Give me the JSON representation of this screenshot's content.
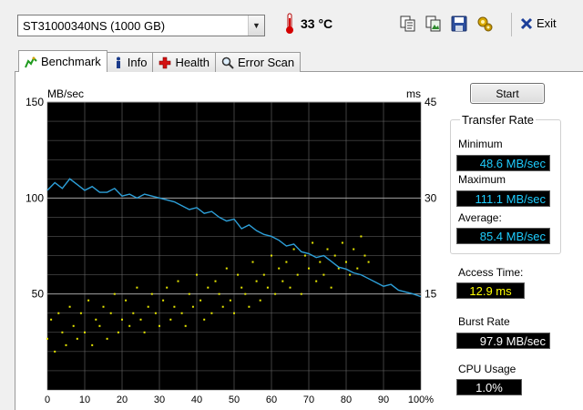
{
  "toolbar": {
    "drive": "ST31000340NS (1000 GB)",
    "temperature": "33 °C",
    "exit_label": "Exit",
    "icons": [
      "copy-text-icon",
      "copy-image-icon",
      "save-icon",
      "options-icon"
    ]
  },
  "tabs": [
    {
      "label": "Benchmark",
      "icon": "benchmark-icon",
      "active": true
    },
    {
      "label": "Info",
      "icon": "info-icon",
      "active": false
    },
    {
      "label": "Health",
      "icon": "health-cross-icon",
      "active": false
    },
    {
      "label": "Error Scan",
      "icon": "magnifier-icon",
      "active": false
    }
  ],
  "buttons": {
    "start": "Start"
  },
  "stats": {
    "transfer_rate_title": "Transfer Rate",
    "minimum_label": "Minimum",
    "minimum_value": "48.6 MB/sec",
    "maximum_label": "Maximum",
    "maximum_value": "111.1 MB/sec",
    "average_label": "Average:",
    "average_value": "85.4 MB/sec",
    "access_label": "Access Time:",
    "access_value": "12.9 ms",
    "burst_label": "Burst Rate",
    "burst_value": "97.9 MB/sec",
    "cpu_label": "CPU Usage",
    "cpu_value": "1.0%"
  },
  "colors": {
    "line": "#2d9fd8",
    "dots": "#e8e800",
    "grid": "#6b6b6b",
    "plot_bg": "#000000"
  },
  "chart_data": {
    "type": "line",
    "left_axis_label": "MB/sec",
    "right_axis_label": "ms",
    "left_ticks": [
      150,
      100,
      50
    ],
    "right_ticks": [
      45,
      30,
      15
    ],
    "x_ticks": [
      "0",
      "10",
      "20",
      "30",
      "40",
      "50",
      "60",
      "70",
      "80",
      "90",
      "100%"
    ],
    "xlim": [
      0,
      100
    ],
    "ylim_left": [
      0,
      150
    ],
    "ylim_right": [
      0,
      45
    ],
    "grid": true,
    "series": [
      {
        "axis": "left",
        "x": [
          0,
          2,
          4,
          6,
          8,
          10,
          12,
          14,
          16,
          18,
          20,
          22,
          24,
          26,
          28,
          30,
          32,
          34,
          36,
          38,
          40,
          42,
          44,
          46,
          48,
          50,
          52,
          54,
          56,
          58,
          60,
          62,
          64,
          66,
          68,
          70,
          72,
          74,
          76,
          78,
          80,
          82,
          84,
          86,
          88,
          90,
          92,
          94,
          96,
          98,
          100
        ],
        "values": [
          104,
          108,
          105,
          110,
          107,
          104,
          106,
          103,
          103,
          105,
          101,
          102,
          100,
          102,
          101,
          100,
          99,
          98,
          96,
          94,
          95,
          92,
          93,
          90,
          88,
          89,
          84,
          86,
          83,
          81,
          80,
          78,
          75,
          76,
          72,
          71,
          69,
          70,
          67,
          64,
          63,
          61,
          60,
          58,
          56,
          54,
          55,
          52,
          51,
          50,
          48.6
        ]
      }
    ],
    "access_time_scatter": {
      "axis": "right",
      "x": [
        0,
        1,
        2,
        3,
        4,
        5,
        6,
        7,
        8,
        9,
        10,
        11,
        12,
        13,
        14,
        15,
        16,
        17,
        18,
        19,
        20,
        21,
        22,
        23,
        24,
        25,
        26,
        27,
        28,
        29,
        30,
        31,
        32,
        33,
        34,
        35,
        36,
        37,
        38,
        39,
        40,
        41,
        42,
        43,
        44,
        45,
        46,
        47,
        48,
        49,
        50,
        51,
        52,
        53,
        54,
        55,
        56,
        57,
        58,
        59,
        60,
        61,
        62,
        63,
        64,
        65,
        66,
        67,
        68,
        69,
        70,
        71,
        72,
        73,
        74,
        75,
        76,
        77,
        78,
        79,
        80,
        81,
        82,
        83,
        84,
        85,
        86
      ],
      "values": [
        8,
        11,
        6,
        12,
        9,
        7,
        13,
        10,
        8,
        12,
        9,
        14,
        7,
        11,
        10,
        13,
        8,
        12,
        15,
        9,
        11,
        14,
        10,
        12,
        16,
        11,
        9,
        13,
        15,
        12,
        10,
        14,
        16,
        11,
        13,
        17,
        12,
        10,
        15,
        13,
        18,
        14,
        11,
        16,
        12,
        17,
        15,
        13,
        19,
        14,
        12,
        18,
        16,
        15,
        13,
        20,
        17,
        14,
        18,
        16,
        21,
        15,
        19,
        17,
        20,
        16,
        22,
        18,
        15,
        21,
        19,
        23,
        17,
        20,
        18,
        22,
        16,
        21,
        19,
        23,
        20,
        18,
        22,
        19,
        24,
        21,
        20
      ]
    }
  }
}
